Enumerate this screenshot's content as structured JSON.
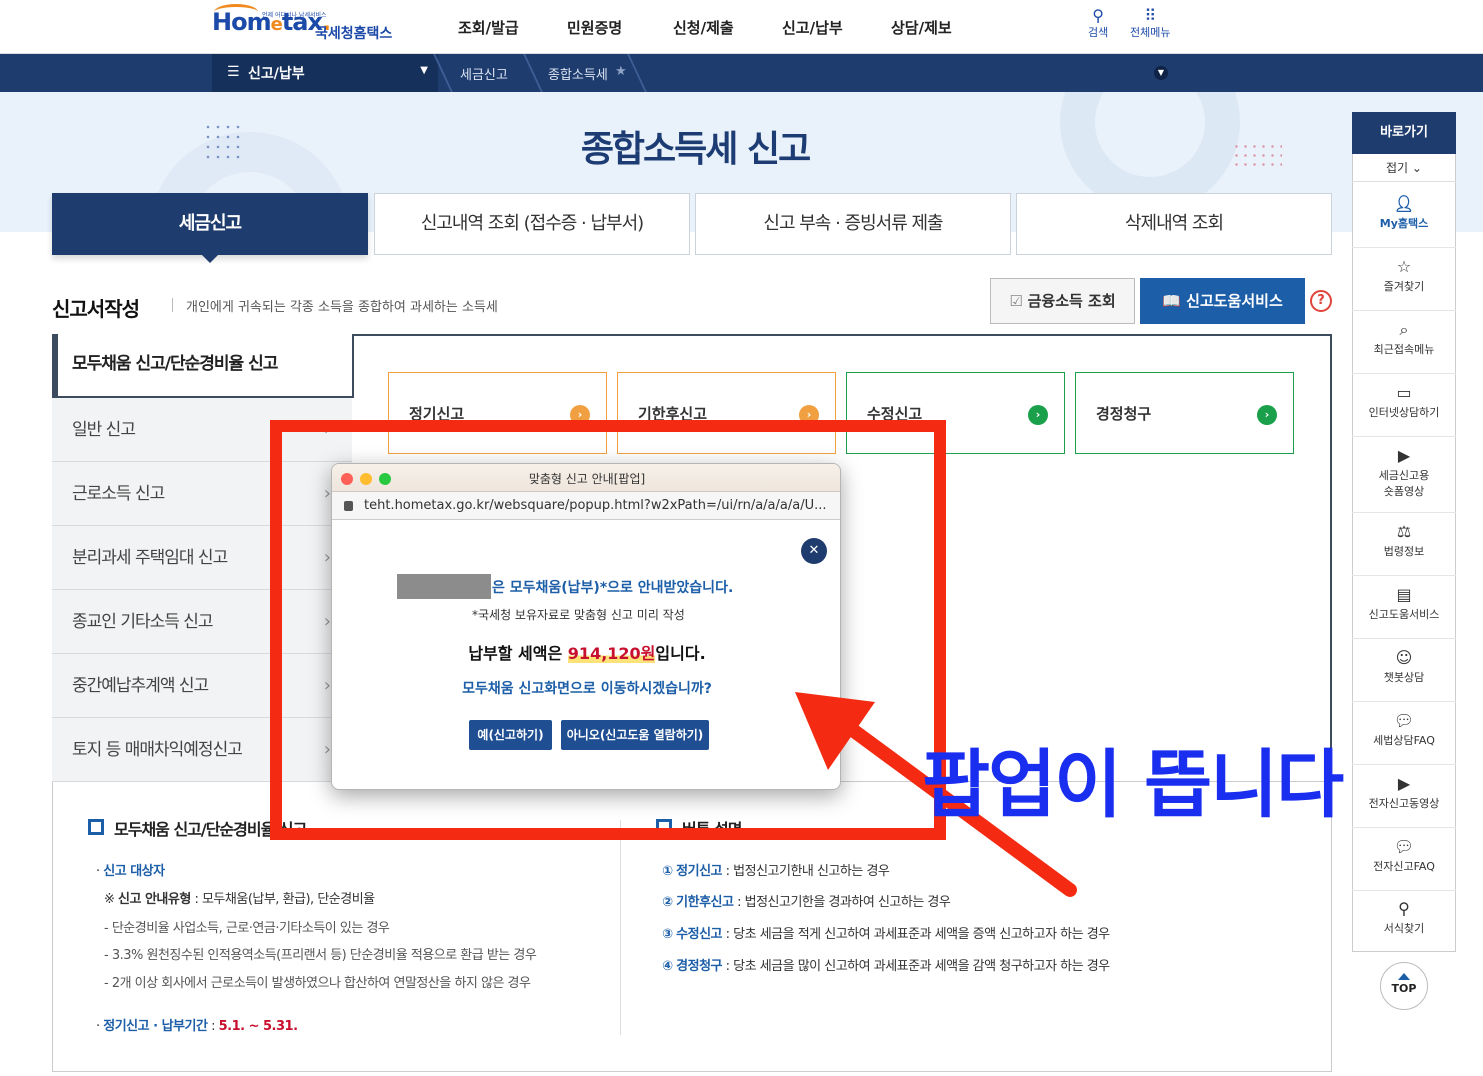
{
  "header": {
    "logo_text": "Hometax",
    "logo_small": "언제 어디서나 납세서비스",
    "logo_sub": "국세청홈택스",
    "nav": [
      "조회/발급",
      "민원증명",
      "신청/제출",
      "신고/납부",
      "상담/제보"
    ],
    "search_label": "검색",
    "allmenu_label": "전체메뉴"
  },
  "breadcrumb": {
    "menu_label": "신고/납부",
    "items": [
      "세금신고",
      "종합소득세"
    ]
  },
  "page_title": "종합소득세 신고",
  "tabs": [
    "세금신고",
    "신고내역 조회 (접수증 · 납부서)",
    "신고 부속 · 증빙서류 제출",
    "삭제내역 조회"
  ],
  "section": {
    "title": "신고서작성",
    "desc": "개인에게 귀속되는 각종 소득을 종합하여 과세하는 소득세",
    "btn_financial": "금융소득 조회",
    "btn_help": "신고도움서비스",
    "help_icon": "?"
  },
  "side_menu": {
    "active": "모두채움 신고/단순경비율 신고",
    "items": [
      "일반 신고",
      "근로소득 신고",
      "분리과세 주택임대 신고",
      "종교인 기타소득 신고",
      "중간예납추계액 신고",
      "토지 등 매매차익예정신고"
    ]
  },
  "options": [
    "정기신고",
    "기한후신고",
    "수정신고",
    "경정청구"
  ],
  "bottom": {
    "left_title": "모두채움 신고/단순경비율 신고",
    "target_label": "신고 대상자",
    "guide_type_label": "신고 안내유형",
    "guide_type_value": " : 모두채움(납부, 환급), 단순경비율",
    "lines": [
      "- 단순경비율 사업소득, 근로·연금·기타소득이 있는 경우",
      "- 3.3% 원천징수된 인적용역소득(프리랜서 등) 단순경비율 적용으로 환급 받는 경우",
      "- 2개 이상 회사에서 근로소득이 발생하였으나 합산하여 연말정산을 하지 않은 경우"
    ],
    "period_label": "정기신고 · 납부기간",
    "period_value": "5.1. ~ 5.31.",
    "right_title": "버튼 설명",
    "right_items": [
      {
        "num": "①",
        "name": "정기신고",
        "desc": " : 법정신고기한내 신고하는 경우"
      },
      {
        "num": "②",
        "name": "기한후신고",
        "desc": " : 법정신고기한을 경과하여 신고하는 경우"
      },
      {
        "num": "③",
        "name": "수정신고",
        "desc": " : 당초 세금을 적게 신고하여 과세표준과 세액을 증액 신고하고자 하는 경우"
      },
      {
        "num": "④",
        "name": "경정청구",
        "desc": " : 당초 세금을 많이 신고하여 과세표준과 세액을 감액 청구하고자 하는 경우"
      }
    ]
  },
  "quick_menu": {
    "head": "바로가기",
    "fold": "접기 ⌄",
    "items": [
      "My홈택스",
      "즐겨찾기",
      "최근접속메뉴",
      "인터넷상담하기",
      "세금신고용 숏폼영상",
      "법령정보",
      "신고도움서비스",
      "챗봇상담",
      "세법상담FAQ",
      "전자신고동영상",
      "전자신고FAQ",
      "서식찾기"
    ],
    "top": "TOP"
  },
  "popup": {
    "window_title": "맞춤형 신고 안내[팝업]",
    "url": "teht.hometax.go.kr/websquare/popup.html?w2xPath=/ui/rn/a/a/a/a/U...",
    "line1": "은 모두채움(납부)*으로 안내받았습니다.",
    "line2": "*국세청 보유자료로 맞춤형 신고 미리 작성",
    "amount_prefix": "납부할 세액은 ",
    "amount": "914,120원",
    "amount_suffix": "입니다.",
    "question": "모두채움 신고화면으로 이동하시겠습니까?",
    "btn_yes": "예(신고하기)",
    "btn_no": "아니오(신고도움 열람하기)"
  },
  "annotation": "팝업이 뜹니다",
  "colors": {
    "navy": "#1f3c6e",
    "blue": "#1c5ea8",
    "orange_card": "#f0a040",
    "green_card": "#1aa04a",
    "annotation_red": "#f52a12",
    "annotation_blue": "#1a2ef0"
  }
}
